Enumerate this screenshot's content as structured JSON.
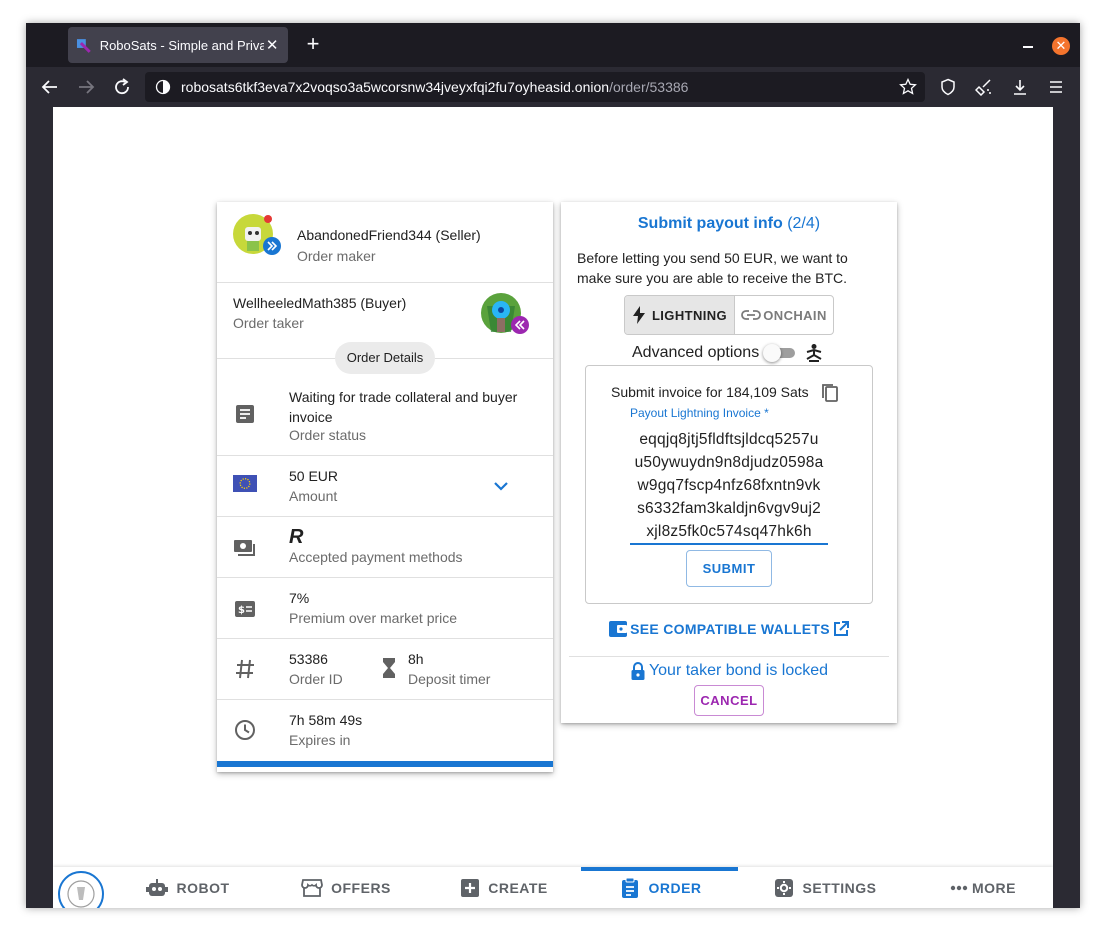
{
  "browser": {
    "tab_title": "RoboSats - Simple and Private",
    "url_host": "robosats6tkf3eva7x2voqso3a5wcorsnw34jveyxfqi2fu7oyheasid.onion",
    "url_path": "/order/53386"
  },
  "order": {
    "maker_name": "AbandonedFriend344 (Seller)",
    "maker_role": "Order maker",
    "taker_name": "WellheeledMath385 (Buyer)",
    "taker_role": "Order taker",
    "details_chip": "Order Details",
    "status_value": "Waiting for trade collateral and buyer invoice",
    "status_label": "Order status",
    "amount_value": "50 EUR",
    "amount_label": "Amount",
    "payment_glyph": "R",
    "payment_label": "Accepted payment methods",
    "premium_value": "7%",
    "premium_label": "Premium over market price",
    "order_id_value": "53386",
    "order_id_label": "Order ID",
    "deposit_value": "8h",
    "deposit_label": "Deposit timer",
    "expires_value": "7h 58m 49s",
    "expires_label": "Expires in",
    "progress": 1.0
  },
  "payout": {
    "title": "Submit payout info",
    "step": "(2/4)",
    "description": "Before letting you send 50 EUR, we want to make sure you are able to receive the BTC.",
    "lightning_label": "LIGHTNING",
    "onchain_label": "ONCHAIN",
    "advanced_label": "Advanced options",
    "invoice_label": "Submit invoice for 184,109 Sats",
    "field_label": "Payout Lightning Invoice *",
    "invoice_lines": [
      "eqqjq8jtj5fldftsjldcq5257u",
      "u50ywuydn9n8djudz0598a",
      "w9gq7fscp4nfz68fxntn9vk",
      "s6332fam3kaldjn6vgv9uj2",
      "xjl8z5fk0c574sq47hk6h"
    ],
    "submit_label": "SUBMIT",
    "wallets_label": "SEE COMPATIBLE WALLETS",
    "bond_text": "Your taker bond is locked",
    "cancel_label": "CANCEL"
  },
  "bottom_nav": {
    "robot": "ROBOT",
    "offers": "OFFERS",
    "create": "CREATE",
    "order": "ORDER",
    "settings": "SETTINGS",
    "more": "MORE"
  },
  "colors": {
    "primary": "#1976d2",
    "secondary": "#9c27b0",
    "browser_chrome": "#2b2a33"
  }
}
